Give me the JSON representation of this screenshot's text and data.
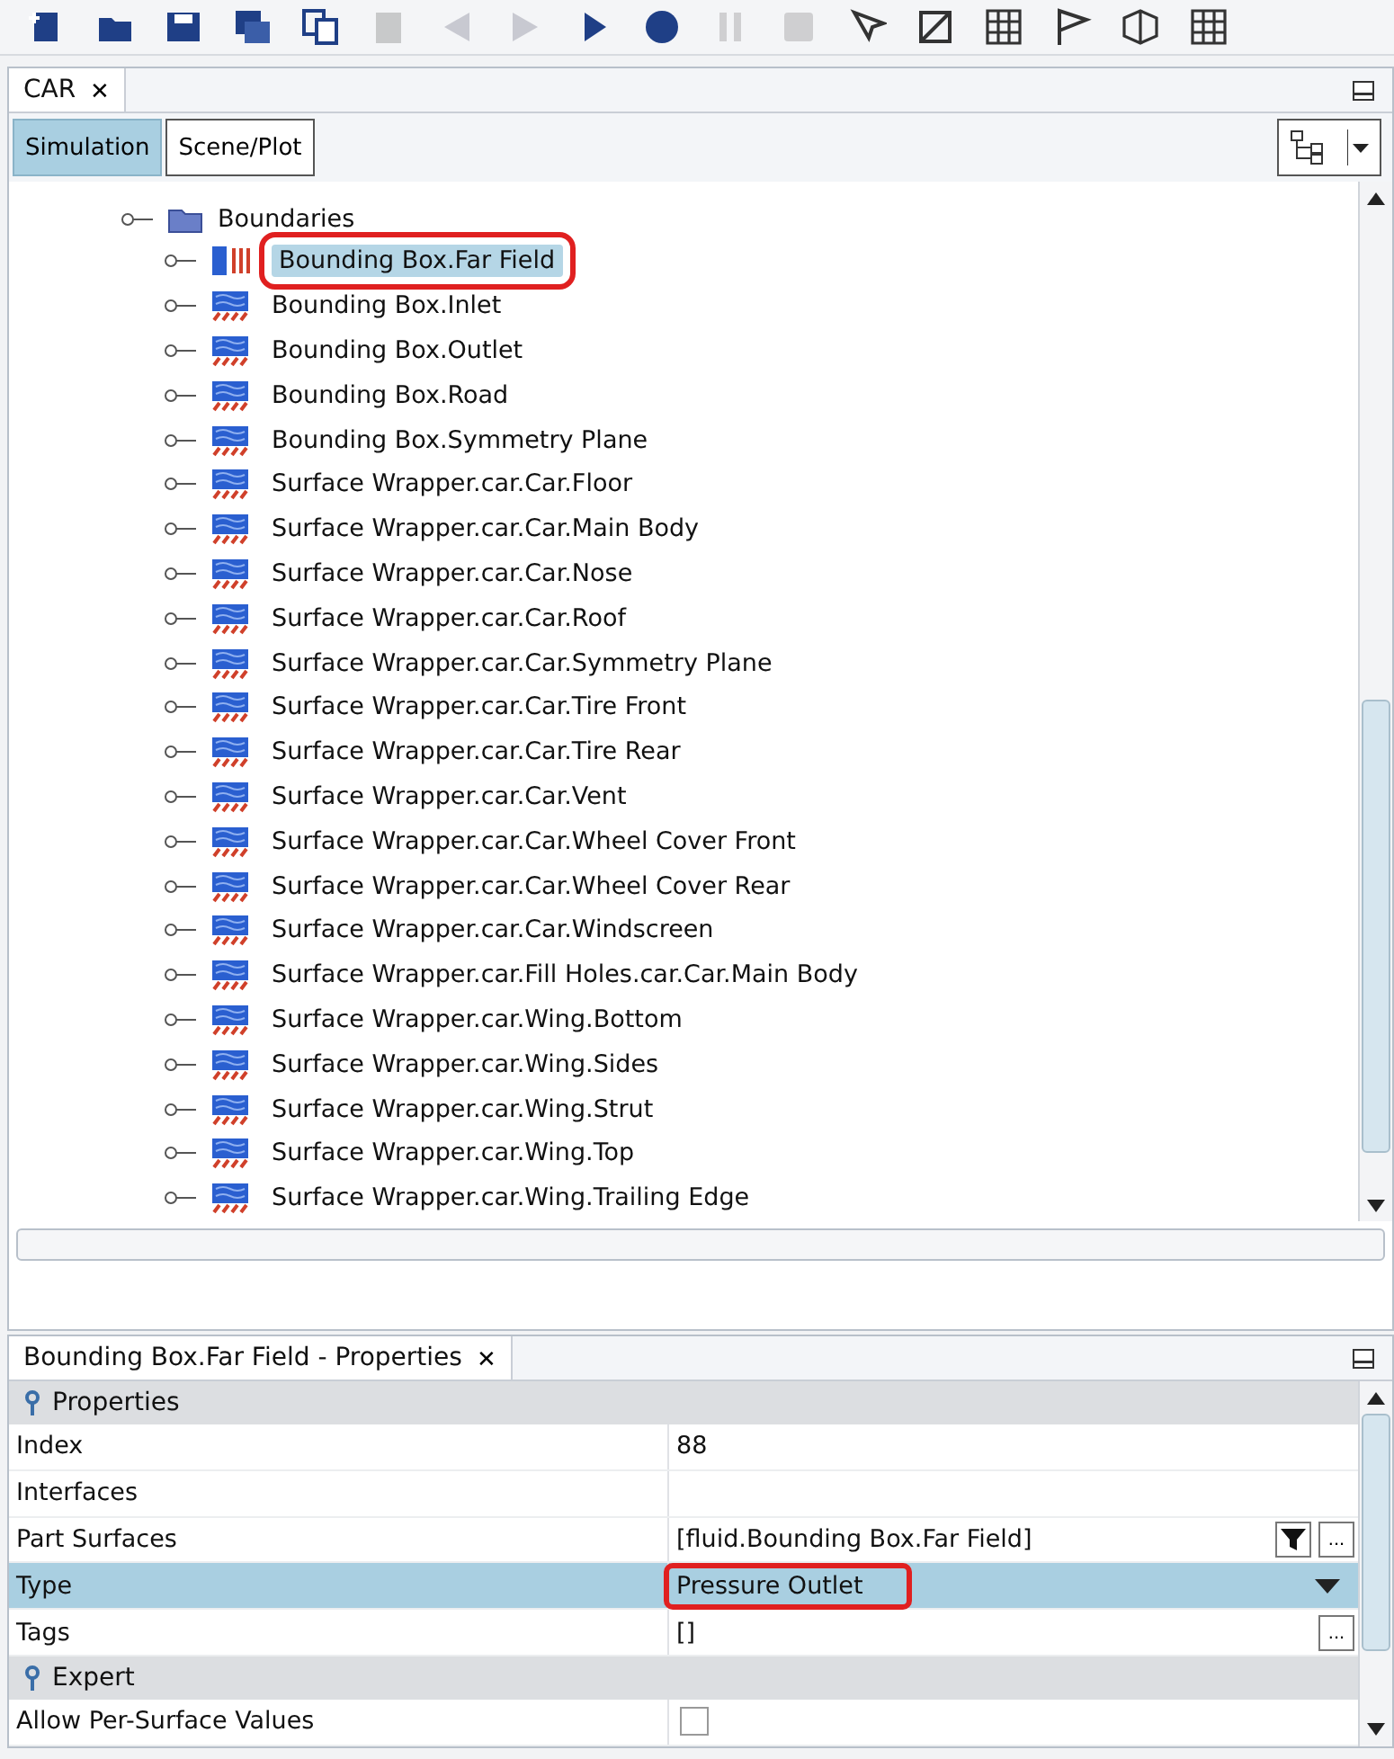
{
  "toolbar": {
    "buttons": [
      {
        "kind": "new",
        "disabled": false
      },
      {
        "kind": "open",
        "disabled": false
      },
      {
        "kind": "save",
        "disabled": false
      },
      {
        "kind": "saveas",
        "disabled": false
      },
      {
        "kind": "copy",
        "disabled": false
      },
      {
        "kind": "paste",
        "disabled": true
      },
      {
        "kind": "back",
        "disabled": true
      },
      {
        "kind": "forward",
        "disabled": true
      },
      {
        "kind": "run",
        "disabled": false
      },
      {
        "kind": "record",
        "disabled": false
      },
      {
        "kind": "pause",
        "disabled": true
      },
      {
        "kind": "stop",
        "disabled": true
      },
      {
        "kind": "pointer",
        "disabled": false
      },
      {
        "kind": "mesh",
        "disabled": false
      },
      {
        "kind": "grid",
        "disabled": false
      },
      {
        "kind": "flag",
        "disabled": false
      },
      {
        "kind": "cube",
        "disabled": false
      },
      {
        "kind": "grid",
        "disabled": false
      }
    ]
  },
  "simulation_tab": {
    "title": "CAR",
    "close": "✕"
  },
  "view_tabs": [
    {
      "label": "Simulation",
      "selected": true
    },
    {
      "label": "Scene/Plot",
      "selected": false
    }
  ],
  "tree": {
    "folder": {
      "label": "Boundaries",
      "expanded": true
    },
    "items": [
      {
        "label": "Bounding Box.Far Field",
        "kind": "outlet",
        "selected": true,
        "highlighted": true
      },
      {
        "label": "Bounding Box.Inlet",
        "kind": "wall",
        "selected": false,
        "highlighted": false
      },
      {
        "label": "Bounding Box.Outlet",
        "kind": "wall",
        "selected": false,
        "highlighted": false
      },
      {
        "label": "Bounding Box.Road",
        "kind": "wall",
        "selected": false,
        "highlighted": false
      },
      {
        "label": "Bounding Box.Symmetry Plane",
        "kind": "wall",
        "selected": false,
        "highlighted": false
      },
      {
        "label": "Surface Wrapper.car.Car.Floor",
        "kind": "wall",
        "selected": false,
        "highlighted": false
      },
      {
        "label": "Surface Wrapper.car.Car.Main Body",
        "kind": "wall",
        "selected": false,
        "highlighted": false
      },
      {
        "label": "Surface Wrapper.car.Car.Nose",
        "kind": "wall",
        "selected": false,
        "highlighted": false
      },
      {
        "label": "Surface Wrapper.car.Car.Roof",
        "kind": "wall",
        "selected": false,
        "highlighted": false
      },
      {
        "label": "Surface Wrapper.car.Car.Symmetry Plane",
        "kind": "wall",
        "selected": false,
        "highlighted": false
      },
      {
        "label": "Surface Wrapper.car.Car.Tire Front",
        "kind": "wall",
        "selected": false,
        "highlighted": false
      },
      {
        "label": "Surface Wrapper.car.Car.Tire Rear",
        "kind": "wall",
        "selected": false,
        "highlighted": false
      },
      {
        "label": "Surface Wrapper.car.Car.Vent",
        "kind": "wall",
        "selected": false,
        "highlighted": false
      },
      {
        "label": "Surface Wrapper.car.Car.Wheel Cover Front",
        "kind": "wall",
        "selected": false,
        "highlighted": false
      },
      {
        "label": "Surface Wrapper.car.Car.Wheel Cover Rear",
        "kind": "wall",
        "selected": false,
        "highlighted": false
      },
      {
        "label": "Surface Wrapper.car.Car.Windscreen",
        "kind": "wall",
        "selected": false,
        "highlighted": false
      },
      {
        "label": "Surface Wrapper.car.Fill Holes.car.Car.Main Body",
        "kind": "wall",
        "selected": false,
        "highlighted": false
      },
      {
        "label": "Surface Wrapper.car.Wing.Bottom",
        "kind": "wall",
        "selected": false,
        "highlighted": false
      },
      {
        "label": "Surface Wrapper.car.Wing.Sides",
        "kind": "wall",
        "selected": false,
        "highlighted": false
      },
      {
        "label": "Surface Wrapper.car.Wing.Strut",
        "kind": "wall",
        "selected": false,
        "highlighted": false
      },
      {
        "label": "Surface Wrapper.car.Wing.Top",
        "kind": "wall",
        "selected": false,
        "highlighted": false
      },
      {
        "label": "Surface Wrapper.car.Wing.Trailing Edge",
        "kind": "wall",
        "selected": false,
        "highlighted": false
      }
    ]
  },
  "properties": {
    "title": "Bounding Box.Far Field - Properties",
    "close": "✕",
    "sections": [
      {
        "title": "Properties",
        "rows": [
          {
            "name": "Index",
            "value": "88",
            "kind": "text",
            "selected": false
          },
          {
            "name": "Interfaces",
            "value": "",
            "kind": "text",
            "selected": false
          },
          {
            "name": "Part Surfaces",
            "value": "[fluid.Bounding Box.Far Field]",
            "kind": "filter",
            "button": "...",
            "selected": false
          },
          {
            "name": "Type",
            "value": "Pressure Outlet",
            "kind": "dropdown",
            "selected": true,
            "highlighted": true
          },
          {
            "name": "Tags",
            "value": "[]",
            "kind": "more",
            "button": "...",
            "selected": false
          }
        ]
      },
      {
        "title": "Expert",
        "rows": [
          {
            "name": "Allow Per-Surface Values",
            "kind": "checkbox",
            "checked": false,
            "selected": false
          }
        ]
      }
    ]
  }
}
